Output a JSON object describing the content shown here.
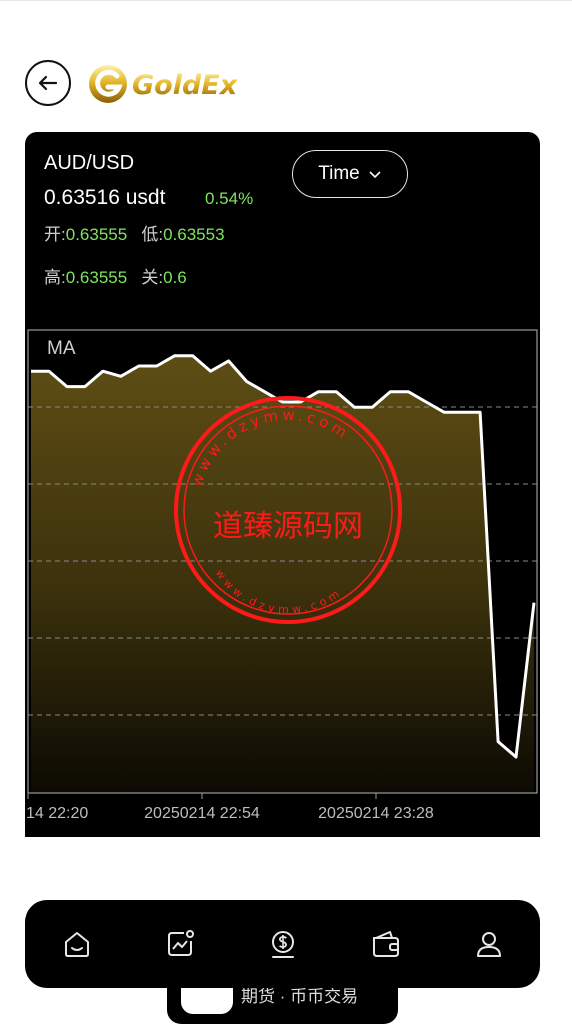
{
  "header": {
    "back_icon": "arrow-left-icon",
    "logo_text": "GoldEx"
  },
  "ticker": {
    "symbol": "AUD/USD",
    "price": "0.63516 usdt",
    "change": "0.54%",
    "open_label": "开:",
    "open_value": "0.63555",
    "low_label": "低:",
    "low_value": "0.63553",
    "high_label": "高:",
    "high_value": "0.63555",
    "close_label": "关:",
    "close_value": "0.6",
    "colors": {
      "up": "#7ee35f"
    }
  },
  "time_selector": {
    "label": "Time",
    "icon": "chevron-down-icon"
  },
  "chart_data": {
    "type": "area",
    "title": "",
    "indicator_label": "MA",
    "xlabel": "",
    "ylabel": "",
    "x_tick_labels": [
      "14 22:20",
      "20250214 22:54",
      "20250214 23:28"
    ],
    "values": [
      0.6372,
      0.6372,
      0.6369,
      0.6369,
      0.6372,
      0.6371,
      0.6373,
      0.6373,
      0.6375,
      0.6375,
      0.6372,
      0.6374,
      0.637,
      0.6368,
      0.6366,
      0.6366,
      0.6368,
      0.6368,
      0.6365,
      0.6365,
      0.6368,
      0.6368,
      0.6366,
      0.6364,
      0.6364,
      0.6364,
      0.63,
      0.6297,
      0.6327
    ],
    "ylim": [
      0.629,
      0.638
    ],
    "grid": "horizontal dashed",
    "line_color": "#ffffff",
    "fill_color": "#5e4d14"
  },
  "watermark": {
    "text": "道臻源码网",
    "url_text": "www.dzymw.com",
    "color": "#ff1a1a"
  },
  "bottom_nav": {
    "items": [
      {
        "icon": "home-icon"
      },
      {
        "icon": "chart-icon"
      },
      {
        "icon": "dollar-coin-icon"
      },
      {
        "icon": "wallet-icon"
      },
      {
        "icon": "user-icon"
      }
    ]
  },
  "toast": {
    "text": "期货 · 币币交易"
  }
}
